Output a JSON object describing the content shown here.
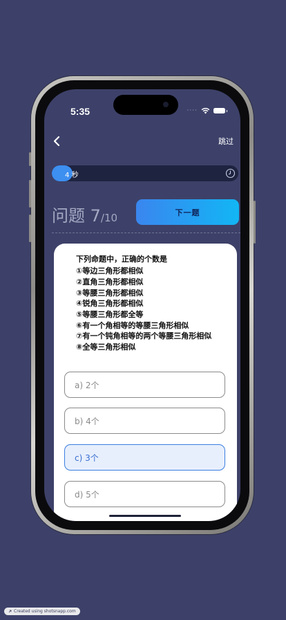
{
  "status_bar": {
    "time": "5:35",
    "signal": "····"
  },
  "nav": {
    "skip_label": "跳过"
  },
  "timer": {
    "seconds": "4",
    "unit": "秒",
    "remaining_fraction": 0.11
  },
  "question": {
    "prefix": "问题",
    "number": "7",
    "total": "/10",
    "next_label": "下一题",
    "title": "下列命题中，正确的个数是",
    "statements": [
      "①等边三角形都相似",
      "②直角三角形都相似",
      "③等腰三角形都相似",
      "④锐角三角形都相似",
      "⑤等腰三角形都全等",
      "⑥有一个角相等的等腰三角形相似",
      "⑦有一个钝角相等的两个等腰三角形相似",
      "⑧全等三角形相似"
    ]
  },
  "options": [
    {
      "label": "a)  2个",
      "selected": false
    },
    {
      "label": "b)  4个",
      "selected": false
    },
    {
      "label": "c)  3个",
      "selected": true
    },
    {
      "label": "d)  5个",
      "selected": false
    }
  ],
  "footer": {
    "badge_text": "Created using shotsnapp.com"
  },
  "colors": {
    "background": "#3d4169",
    "accent": "#3a86ef",
    "selected_bg": "#e7effd"
  }
}
